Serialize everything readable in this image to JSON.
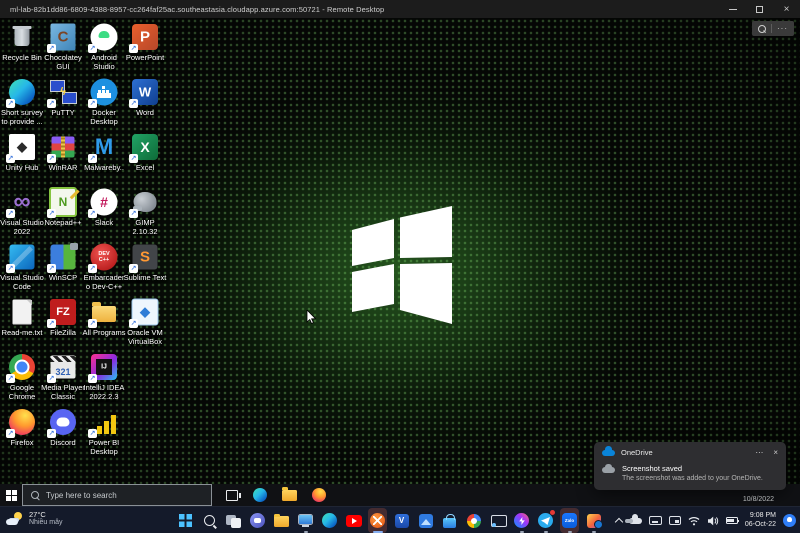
{
  "window": {
    "title": "ml-lab-82b1dd86-6809-4388-8957-cc264faf25ac.southeastasia.cloudapp.azure.com:50721 - Remote Desktop",
    "close_glyph": "×"
  },
  "rdp_toolbar": {
    "more_glyph": "···"
  },
  "desktop": {
    "icons": [
      {
        "id": "recycle-bin",
        "label": "Recycle Bin",
        "art": "i-recycle",
        "shortcut": false
      },
      {
        "id": "chocolatey-gui",
        "label": "Chocolatey GUI",
        "art": "i-choco",
        "glyph": "C",
        "shortcut": true
      },
      {
        "id": "android-studio",
        "label": "Android Studio",
        "art": "i-android",
        "shortcut": true
      },
      {
        "id": "powerpoint",
        "label": "PowerPoint",
        "art": "i-ppt",
        "glyph": "P",
        "shortcut": true
      },
      {
        "id": "short-survey",
        "label": "Short survey to provide ...",
        "art": "i-edgeball",
        "shortcut": true
      },
      {
        "id": "putty",
        "label": "PuTTY",
        "art": "i-putty",
        "glyph": "ϟ",
        "shortcut": true
      },
      {
        "id": "docker-desktop",
        "label": "Docker Desktop",
        "art": "i-docker",
        "shortcut": true
      },
      {
        "id": "word",
        "label": "Word",
        "art": "i-word",
        "glyph": "W",
        "shortcut": true
      },
      {
        "id": "unity-hub",
        "label": "Unity Hub",
        "art": "i-unity",
        "glyph": "◆",
        "shortcut": true
      },
      {
        "id": "winrar",
        "label": "WinRAR",
        "art": "i-winrar",
        "shortcut": true
      },
      {
        "id": "malwarebytes",
        "label": "Malwareby..",
        "art": "i-malware",
        "glyph": "M",
        "shortcut": true
      },
      {
        "id": "excel",
        "label": "Excel",
        "art": "i-excel",
        "glyph": "X",
        "shortcut": true
      },
      {
        "id": "visual-studio-2022",
        "label": "Visual Studio 2022",
        "art": "i-vs22",
        "glyph": "∞",
        "shortcut": true
      },
      {
        "id": "notepad-plus-plus",
        "label": "Notepad++",
        "art": "i-npp",
        "glyph": "N",
        "shortcut": true
      },
      {
        "id": "slack",
        "label": "Slack",
        "art": "i-slack",
        "glyph": "#",
        "shortcut": true
      },
      {
        "id": "gimp",
        "label": "GIMP 2.10.32",
        "art": "i-gimp",
        "shortcut": true
      },
      {
        "id": "visual-studio-code",
        "label": "Visual Studio Code",
        "art": "i-vscode",
        "shortcut": true
      },
      {
        "id": "winscp",
        "label": "WinSCP",
        "art": "i-winscp",
        "shortcut": true
      },
      {
        "id": "dev-cpp",
        "label": "Embarcadero Dev-C++",
        "art": "i-devcpp",
        "glyph": "DEV C++",
        "shortcut": true
      },
      {
        "id": "sublime-text",
        "label": "Sublime Text",
        "art": "i-sublime",
        "glyph": "S",
        "shortcut": true
      },
      {
        "id": "read-me",
        "label": "Read-me.txt",
        "art": "i-readme",
        "shortcut": false
      },
      {
        "id": "filezilla",
        "label": "FileZilla",
        "art": "i-filezilla",
        "glyph": "FZ",
        "shortcut": true
      },
      {
        "id": "all-programs",
        "label": "All Programs",
        "art": "i-allprog",
        "shortcut": true
      },
      {
        "id": "virtualbox",
        "label": "Oracle VM VirtualBox",
        "art": "i-vbox",
        "glyph": "◆",
        "shortcut": true
      },
      {
        "id": "google-chrome",
        "label": "Google Chrome",
        "art": "i-chrome",
        "shortcut": true
      },
      {
        "id": "media-player-classic",
        "label": "Media Player Classic",
        "art": "i-mpc",
        "glyph": "321",
        "shortcut": true
      },
      {
        "id": "intellij-idea",
        "label": "IntelliJ IDEA 2022.2.3",
        "art": "i-intellij",
        "glyph": "IJ",
        "shortcut": true
      },
      {
        "id": "firefox",
        "label": "Firefox",
        "art": "i-firefox",
        "shortcut": true
      },
      {
        "id": "discord",
        "label": "Discord",
        "art": "i-discord",
        "shortcut": true
      },
      {
        "id": "power-bi",
        "label": "Power BI Desktop",
        "art": "i-powerbi",
        "shortcut": true
      }
    ]
  },
  "toast": {
    "app": "OneDrive",
    "more_glyph": "⋯",
    "close_glyph": "×",
    "title": "Screenshot saved",
    "body": "The screenshot was added to your OneDrive."
  },
  "remote_taskbar": {
    "search_placeholder": "Type here to search",
    "tray_date": "10/8/2022"
  },
  "host_taskbar": {
    "weather_temp": "27°C",
    "weather_condition": "Nhiều mây",
    "clock_time": "9:08 PM",
    "clock_date": "06-Oct-22",
    "center_icons": [
      {
        "name": "start"
      },
      {
        "name": "search"
      },
      {
        "name": "task-view"
      },
      {
        "name": "chat"
      },
      {
        "name": "file-explorer"
      },
      {
        "name": "this-pc",
        "running": true
      },
      {
        "name": "edge"
      },
      {
        "name": "youtube"
      },
      {
        "name": "remote-desktop",
        "active": true,
        "highlighted": true
      },
      {
        "name": "v-app",
        "glyph": "V"
      },
      {
        "name": "mountain-app"
      },
      {
        "name": "microsoft-store"
      },
      {
        "name": "google"
      },
      {
        "name": "cast"
      },
      {
        "name": "messenger",
        "running": true
      },
      {
        "name": "telegram",
        "running": true,
        "badge": true
      },
      {
        "name": "zalo",
        "glyph": "Zalo",
        "running": true,
        "highlighted": true
      },
      {
        "name": "photos",
        "running": true
      }
    ]
  }
}
